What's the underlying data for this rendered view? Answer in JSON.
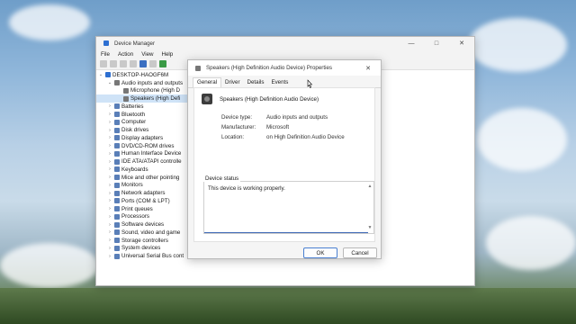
{
  "device_manager": {
    "title": "Device Manager",
    "menu": [
      "File",
      "Action",
      "View",
      "Help"
    ],
    "tree": [
      {
        "label": "DESKTOP-HAOGF6M",
        "level": 0,
        "expanded": true,
        "icon": "computer-icon"
      },
      {
        "label": "Audio inputs and outputs",
        "level": 1,
        "expanded": true,
        "icon": "speaker-icon"
      },
      {
        "label": "Microphone (High D",
        "level": 2,
        "icon": "speaker-icon"
      },
      {
        "label": "Speakers (High Defi",
        "level": 2,
        "icon": "speaker-icon",
        "selected": true
      },
      {
        "label": "Batteries",
        "level": 1,
        "icon": "device-icon"
      },
      {
        "label": "Bluetooth",
        "level": 1,
        "icon": "device-icon"
      },
      {
        "label": "Computer",
        "level": 1,
        "icon": "device-icon"
      },
      {
        "label": "Disk drives",
        "level": 1,
        "icon": "device-icon"
      },
      {
        "label": "Display adapters",
        "level": 1,
        "icon": "device-icon"
      },
      {
        "label": "DVD/CD-ROM drives",
        "level": 1,
        "icon": "device-icon"
      },
      {
        "label": "Human Interface Device",
        "level": 1,
        "icon": "device-icon"
      },
      {
        "label": "IDE ATA/ATAPI controlle",
        "level": 1,
        "icon": "device-icon"
      },
      {
        "label": "Keyboards",
        "level": 1,
        "icon": "device-icon"
      },
      {
        "label": "Mice and other pointing",
        "level": 1,
        "icon": "device-icon"
      },
      {
        "label": "Monitors",
        "level": 1,
        "icon": "device-icon"
      },
      {
        "label": "Network adapters",
        "level": 1,
        "icon": "device-icon"
      },
      {
        "label": "Ports (COM & LPT)",
        "level": 1,
        "icon": "device-icon"
      },
      {
        "label": "Print queues",
        "level": 1,
        "icon": "device-icon"
      },
      {
        "label": "Processors",
        "level": 1,
        "icon": "device-icon"
      },
      {
        "label": "Software devices",
        "level": 1,
        "icon": "device-icon"
      },
      {
        "label": "Sound, video and game",
        "level": 1,
        "icon": "device-icon"
      },
      {
        "label": "Storage controllers",
        "level": 1,
        "icon": "device-icon"
      },
      {
        "label": "System devices",
        "level": 1,
        "icon": "device-icon"
      },
      {
        "label": "Universal Serial Bus cont",
        "level": 1,
        "icon": "device-icon"
      }
    ]
  },
  "dialog": {
    "title": "Speakers (High Definition Audio Device) Properties",
    "tabs": [
      "General",
      "Driver",
      "Details",
      "Events"
    ],
    "device_name": "Speakers (High Definition Audio Device)",
    "fields": [
      {
        "key": "Device type:",
        "value": "Audio inputs and outputs"
      },
      {
        "key": "Manufacturer:",
        "value": "Microsoft"
      },
      {
        "key": "Location:",
        "value": "on High Definition Audio Device"
      }
    ],
    "status_label": "Device status",
    "status_text": "This device is working properly.",
    "ok": "OK",
    "cancel": "Cancel"
  }
}
